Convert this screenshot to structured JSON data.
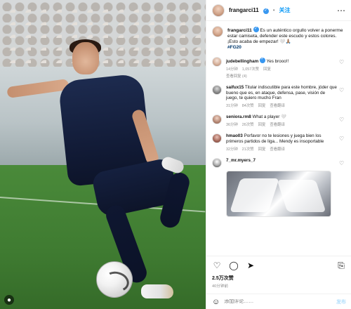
{
  "header": {
    "username": "frangarci11",
    "follow_label": "关注",
    "more_icon": "more-horizontal-icon"
  },
  "caption": {
    "username": "frangarci11",
    "text": "Es un auténtico orgullo volver a ponerme estar camiseta, defender este escudo y estos colores. ¡Esto acaba de empezar! 🤍🙏🏽",
    "hashtag": "#FG20"
  },
  "comments": [
    {
      "username": "judebellingham",
      "text": "Yes brooo!!",
      "time": "14分钟",
      "likes": "1,057次赞",
      "reply": "回复",
      "replies_link": "查看回复 (4)"
    },
    {
      "username": "saifux15",
      "text": "Titular indiscutible para este hombre, jóder que bueno que es, en ataque, defensa, pase, visión de juego, te quiero mucho Fran",
      "time": "31分钟",
      "likes": "84次赞",
      "reply": "回复",
      "replies_link": "查看翻译"
    },
    {
      "username": "seniora.rm8",
      "text": "What a player 🤍",
      "time": "36分钟",
      "likes": "26次赞",
      "reply": "回复",
      "replies_link": "查看翻译"
    },
    {
      "username": "hmao03",
      "text": "Porfavor no te lesiones y juega bien los primeros partidos de liga... Mendy es insoportable",
      "time": "32分钟",
      "likes": "21次赞",
      "reply": "回复",
      "replies_link": "查看翻译"
    },
    {
      "username": "7_mr.myers_7",
      "text": "",
      "time": "",
      "likes": "",
      "reply": "",
      "replies_link": ""
    }
  ],
  "actions": {
    "likes_text": "2.5万次赞",
    "date_text": "40分钟前"
  },
  "comment_bar": {
    "placeholder": "添加评论……",
    "post_label": "发布"
  }
}
